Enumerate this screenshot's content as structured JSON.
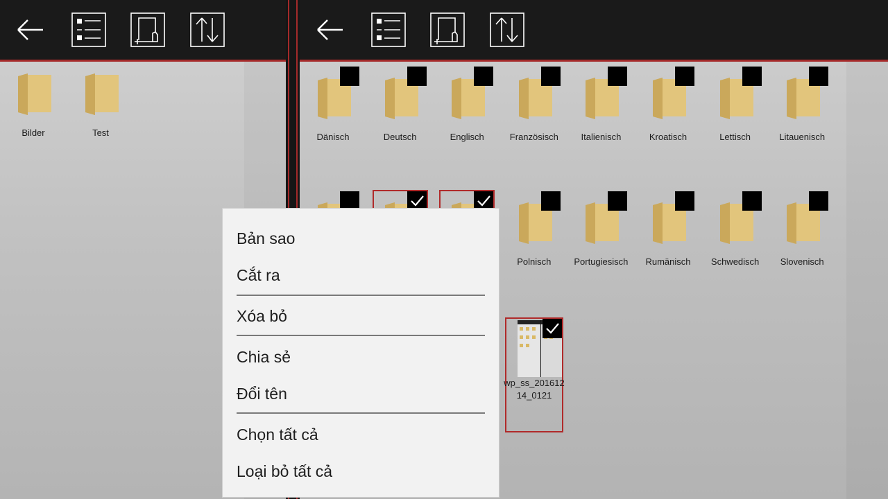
{
  "colors": {
    "toolbar_bg": "#1a1a1a",
    "accent_red": "#a52a2a",
    "folder": "#dcbc70",
    "menu_bg": "#f2f2f2"
  },
  "toolbar_icons": [
    "back-arrow-icon",
    "list-view-icon",
    "new-folder-icon",
    "sort-icon"
  ],
  "left_panel": {
    "folders": [
      {
        "name": "Bilder",
        "selected": false
      },
      {
        "name": "Test",
        "selected": false
      }
    ]
  },
  "right_panel": {
    "folders": [
      {
        "name": "Dänisch",
        "selected": false
      },
      {
        "name": "Deutsch",
        "selected": false
      },
      {
        "name": "Englisch",
        "selected": false
      },
      {
        "name": "Französisch",
        "selected": false
      },
      {
        "name": "Italienisch",
        "selected": false
      },
      {
        "name": "Kroatisch",
        "selected": false
      },
      {
        "name": "Lettisch",
        "selected": false
      },
      {
        "name": "Litauenisch",
        "selected": false
      },
      {
        "name": "",
        "selected": false
      },
      {
        "name": "",
        "selected": true
      },
      {
        "name": "",
        "selected": true
      },
      {
        "name": "Polnisch",
        "selected": false
      },
      {
        "name": "Portugiesisch",
        "selected": false
      },
      {
        "name": "Rumänisch",
        "selected": false
      },
      {
        "name": "Schwedisch",
        "selected": false
      },
      {
        "name": "Slovenisch",
        "selected": false
      }
    ],
    "file": {
      "name": "wp_ss_20161214_0121",
      "selected": true
    }
  },
  "context_menu": {
    "items": [
      {
        "label": "Bản sao"
      },
      {
        "label": "Cắt ra"
      },
      {
        "label": "Xóa bỏ"
      },
      {
        "label": "Chia sẻ"
      },
      {
        "label": "Đổi tên"
      },
      {
        "label": "Chọn tất cả"
      },
      {
        "label": "Loại bỏ tất cả"
      }
    ]
  }
}
